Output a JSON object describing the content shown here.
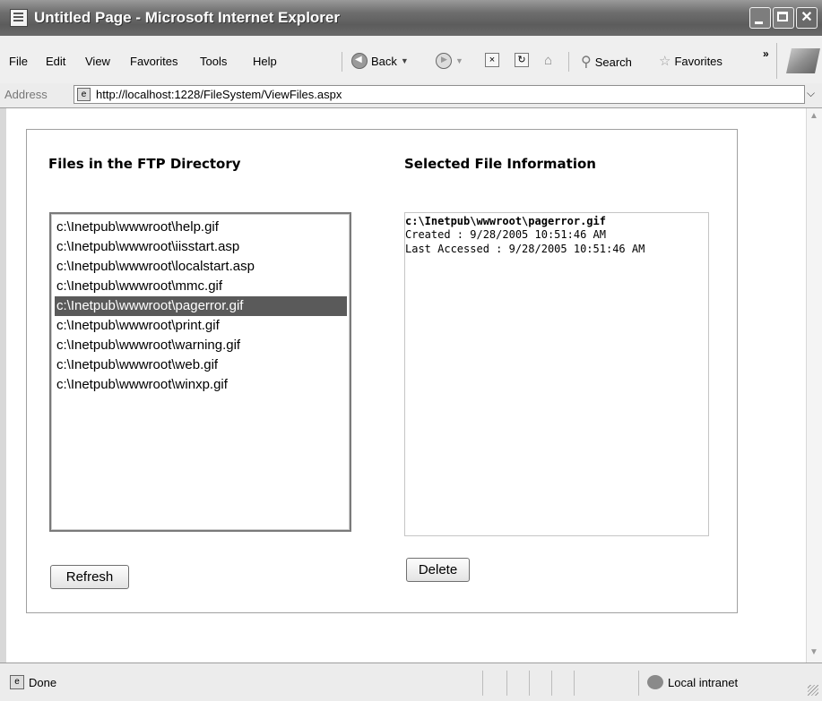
{
  "window": {
    "title": "Untitled Page - Microsoft Internet Explorer"
  },
  "menu": {
    "items": [
      "File",
      "Edit",
      "View",
      "Favorites",
      "Tools",
      "Help"
    ]
  },
  "toolbar": {
    "back_label": "Back",
    "search_label": "Search",
    "favorites_label": "Favorites",
    "more_label": "»"
  },
  "address": {
    "label": "Address",
    "url": "http://localhost:1228/FileSystem/ViewFiles.aspx"
  },
  "page": {
    "files_heading": "Files in the FTP Directory",
    "info_heading": "Selected File Information",
    "files": [
      "c:\\Inetpub\\wwwroot\\help.gif",
      "c:\\Inetpub\\wwwroot\\iisstart.asp",
      "c:\\Inetpub\\wwwroot\\localstart.asp",
      "c:\\Inetpub\\wwwroot\\mmc.gif",
      "c:\\Inetpub\\wwwroot\\pagerror.gif",
      "c:\\Inetpub\\wwwroot\\print.gif",
      "c:\\Inetpub\\wwwroot\\warning.gif",
      "c:\\Inetpub\\wwwroot\\web.gif",
      "c:\\Inetpub\\wwwroot\\winxp.gif"
    ],
    "selected_index": 4,
    "info": {
      "path": "c:\\Inetpub\\wwwroot\\pagerror.gif",
      "created": "Created : 9/28/2005 10:51:46 AM",
      "accessed": "Last Accessed : 9/28/2005 10:51:46 AM"
    },
    "refresh_label": "Refresh",
    "delete_label": "Delete"
  },
  "status": {
    "text": "Done",
    "zone": "Local intranet"
  }
}
